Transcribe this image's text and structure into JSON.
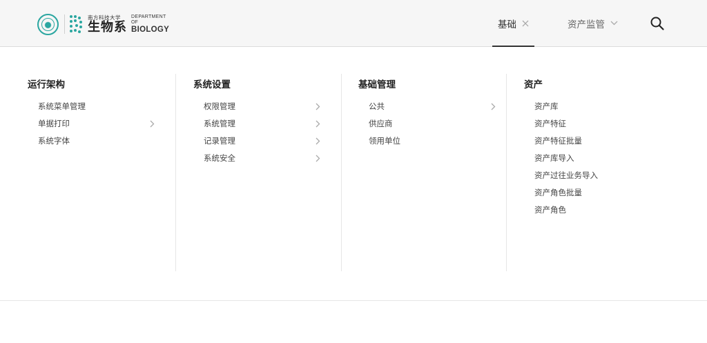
{
  "header": {
    "logo": {
      "cn_small": "南方科技大学",
      "cn_big": "生物系",
      "en_line1": "DEPARTMENT",
      "en_line2": "OF",
      "en_line3": "BIOLOGY"
    },
    "nav": [
      {
        "label": "基础",
        "icon": "close-icon",
        "active": true
      },
      {
        "label": "资产监管",
        "icon": "chevron-down-icon",
        "active": false
      }
    ],
    "search_icon": "search-icon"
  },
  "menu": {
    "columns": [
      {
        "title": "运行架构",
        "items": [
          {
            "label": "系统菜单管理",
            "has_submenu": false
          },
          {
            "label": "单据打印",
            "has_submenu": true
          },
          {
            "label": "系统字体",
            "has_submenu": false
          }
        ]
      },
      {
        "title": "系统设置",
        "items": [
          {
            "label": "权限管理",
            "has_submenu": true
          },
          {
            "label": "系统管理",
            "has_submenu": true
          },
          {
            "label": "记录管理",
            "has_submenu": true
          },
          {
            "label": "系统安全",
            "has_submenu": true
          }
        ]
      },
      {
        "title": "基础管理",
        "items": [
          {
            "label": "公共",
            "has_submenu": true
          },
          {
            "label": "供应商",
            "has_submenu": false
          },
          {
            "label": "领用单位",
            "has_submenu": false
          }
        ]
      },
      {
        "title": "资产",
        "items": [
          {
            "label": "资产库",
            "has_submenu": false
          },
          {
            "label": "资产特征",
            "has_submenu": false
          },
          {
            "label": "资产特征批量",
            "has_submenu": false
          },
          {
            "label": "资产库导入",
            "has_submenu": false
          },
          {
            "label": "资产过往业务导入",
            "has_submenu": false
          },
          {
            "label": "资产角色批量",
            "has_submenu": false
          },
          {
            "label": "资产角色",
            "has_submenu": false
          }
        ]
      }
    ]
  },
  "colors": {
    "accent": "#2aa6a0",
    "header_bg": "#f6f6f6",
    "text": "#333333",
    "chevron": "#aaaaaa"
  }
}
